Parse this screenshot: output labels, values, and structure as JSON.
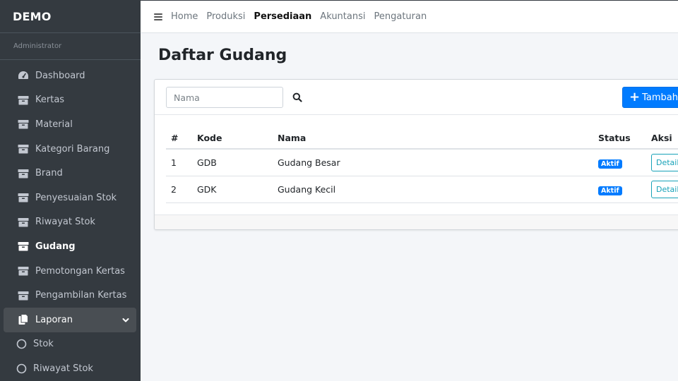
{
  "sidebar": {
    "brand": "DEMO",
    "user": "Administrator",
    "items": [
      {
        "label": "Dashboard",
        "icon": "dashboard-icon"
      },
      {
        "label": "Kertas",
        "icon": "box-icon"
      },
      {
        "label": "Material",
        "icon": "box-icon"
      },
      {
        "label": "Kategori Barang",
        "icon": "box-icon"
      },
      {
        "label": "Brand",
        "icon": "box-icon"
      },
      {
        "label": "Penyesuaian Stok",
        "icon": "box-icon"
      },
      {
        "label": "Riwayat Stok",
        "icon": "box-icon"
      },
      {
        "label": "Gudang",
        "icon": "box-icon",
        "active": true
      },
      {
        "label": "Pemotongan Kertas",
        "icon": "box-icon"
      },
      {
        "label": "Pengambilan Kertas",
        "icon": "box-icon"
      },
      {
        "label": "Laporan",
        "icon": "copy-icon",
        "expanded": true
      },
      {
        "label": "Stok",
        "icon": "circle-icon"
      },
      {
        "label": "Riwayat Stok",
        "icon": "circle-icon"
      }
    ]
  },
  "topbar": {
    "links": [
      "Home",
      "Produksi",
      "Persediaan",
      "Akuntansi",
      "Pengaturan"
    ],
    "active": "Persediaan"
  },
  "page": {
    "title": "Daftar Gudang"
  },
  "search": {
    "placeholder": "Nama"
  },
  "toolbar": {
    "add_label": "Tambah Data"
  },
  "table": {
    "headers": [
      "#",
      "Kode",
      "Nama",
      "Status",
      "Aksi"
    ],
    "rows": [
      {
        "no": "1",
        "kode": "GDB",
        "nama": "Gudang Besar",
        "status": "Aktif",
        "aksi": "Detail"
      },
      {
        "no": "2",
        "kode": "GDK",
        "nama": "Gudang Kecil",
        "status": "Aktif",
        "aksi": "Detail"
      }
    ]
  },
  "colors": {
    "sidebar_bg": "#343a40",
    "primary": "#007bff",
    "info": "#17a2b8"
  }
}
